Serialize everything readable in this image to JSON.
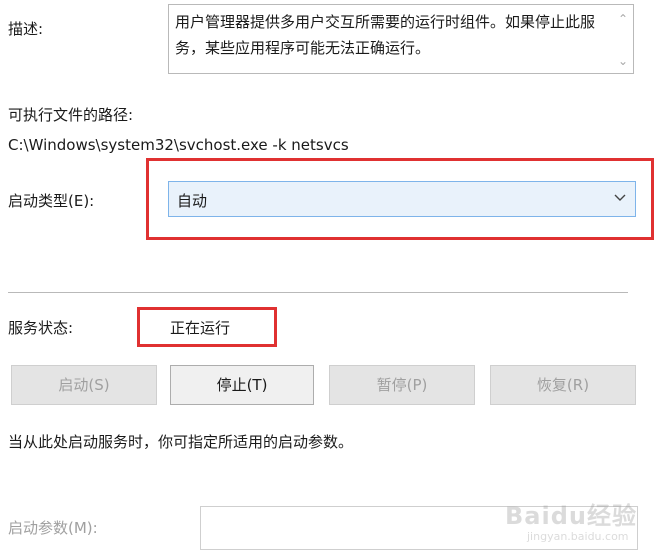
{
  "description": {
    "label": "描述:",
    "text": "用户管理器提供多用户交互所需要的运行时组件。如果停止此服务，某些应用程序可能无法正确运行。"
  },
  "executable": {
    "label": "可执行文件的路径:",
    "path": "C:\\Windows\\system32\\svchost.exe -k netsvcs"
  },
  "startup_type": {
    "label": "启动类型(E):",
    "value": "自动"
  },
  "service_status": {
    "label": "服务状态:",
    "value": "正在运行"
  },
  "buttons": {
    "start": "启动(S)",
    "stop": "停止(T)",
    "pause": "暂停(P)",
    "resume": "恢复(R)"
  },
  "hint": "当从此处启动服务时，你可指定所适用的启动参数。",
  "start_params": {
    "label": "启动参数(M):",
    "value": ""
  },
  "watermark": {
    "brand": "Baidu经验",
    "url": "jingyan.baidu.com"
  },
  "colors": {
    "highlight_red": "#e03131",
    "select_bg": "#e9f2fb",
    "select_border": "#7eb4ea",
    "disabled_text": "#a0a0a0"
  }
}
